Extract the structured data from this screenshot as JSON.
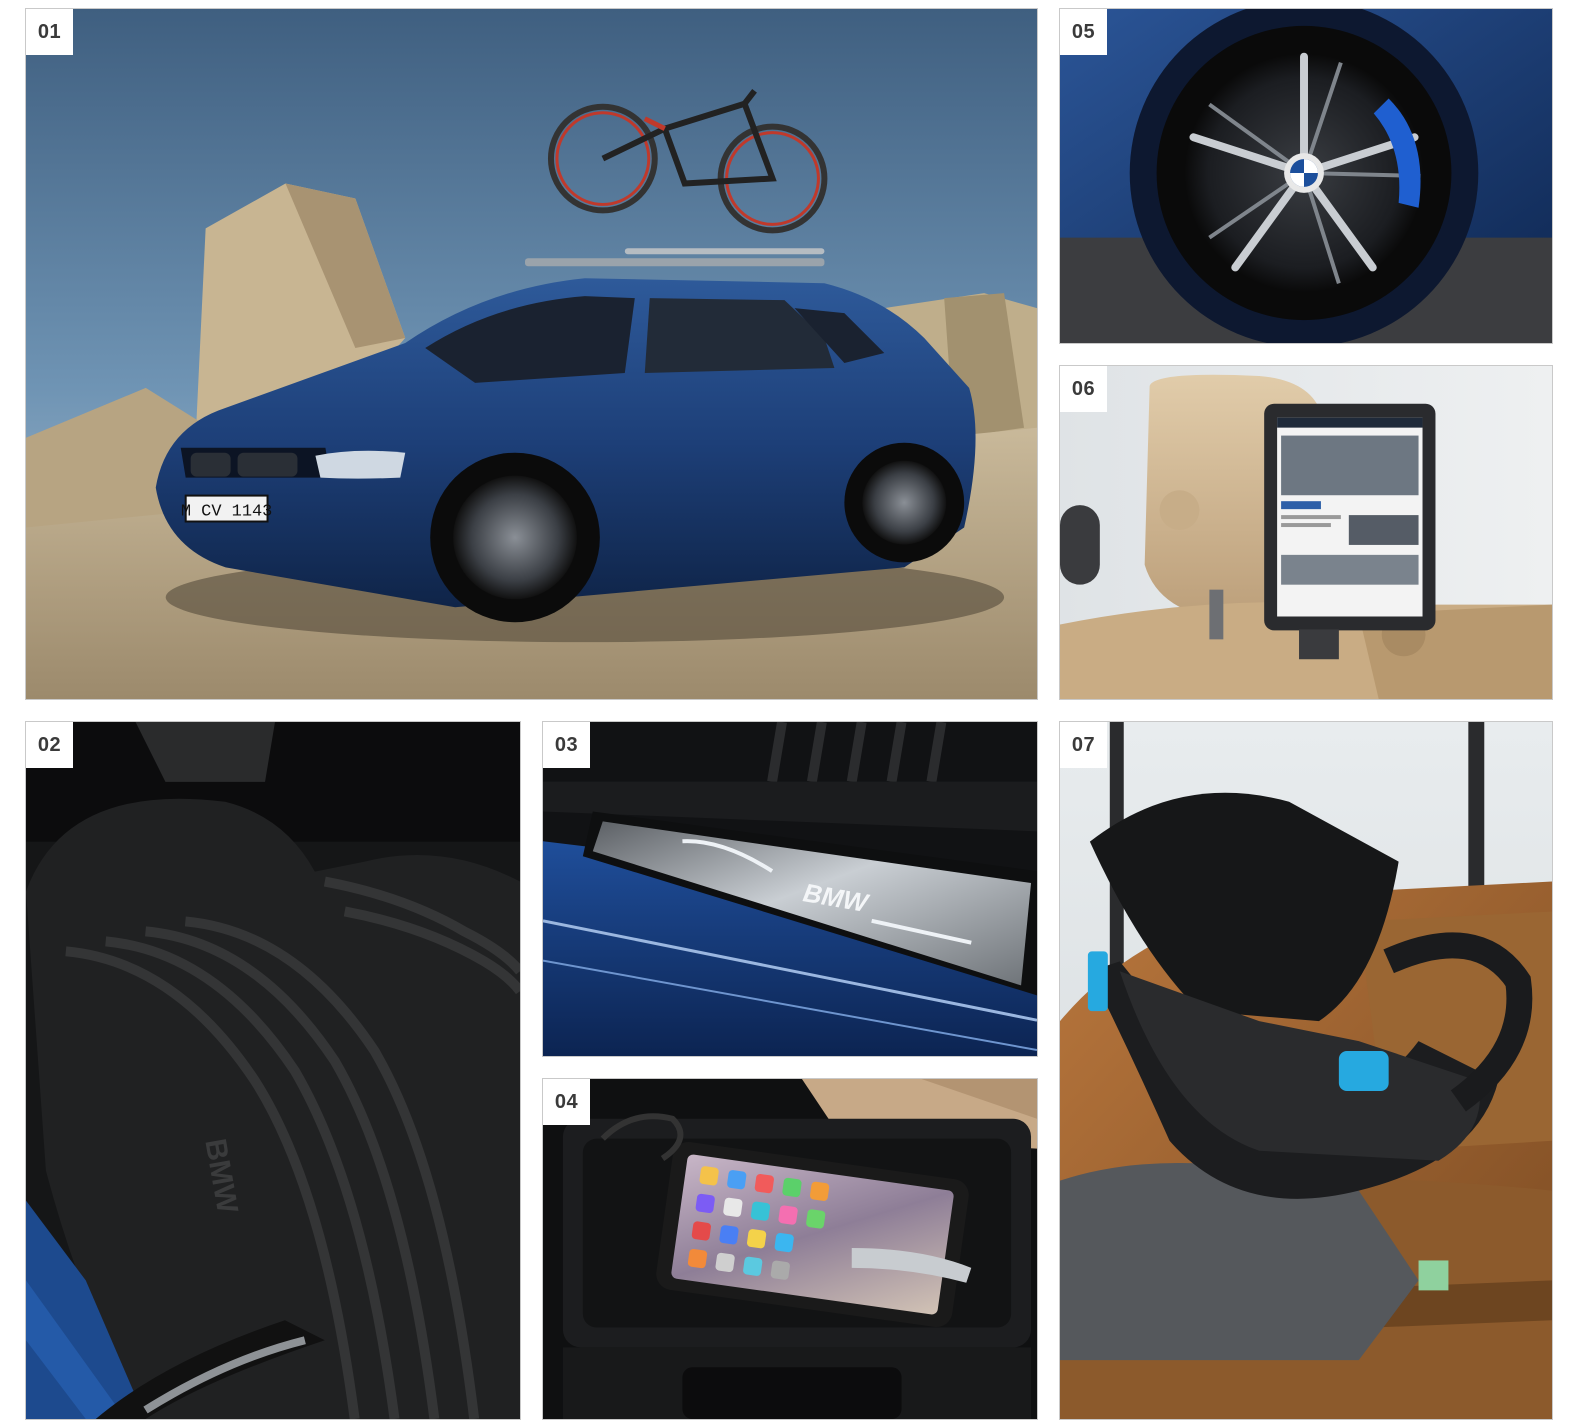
{
  "tiles": [
    {
      "number": "01",
      "plate_text": "M CV 1143"
    },
    {
      "number": "05"
    },
    {
      "number": "06"
    },
    {
      "number": "02",
      "mat_logo": "BMW"
    },
    {
      "number": "03",
      "sill_logo": "BMW"
    },
    {
      "number": "04"
    },
    {
      "number": "07"
    }
  ]
}
